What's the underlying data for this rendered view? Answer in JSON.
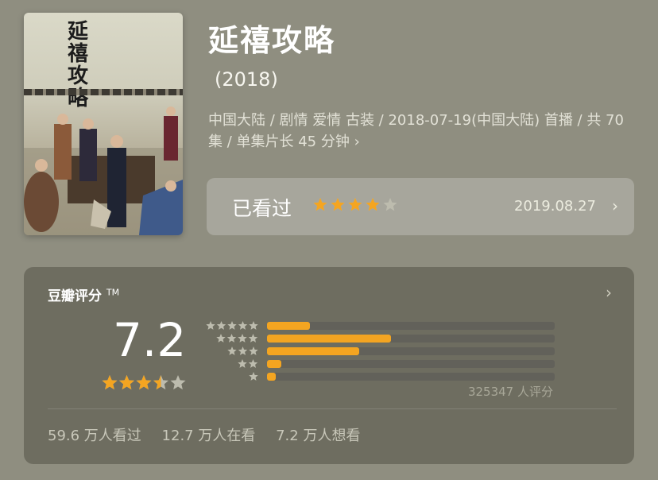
{
  "poster": {
    "title": "延禧攻略"
  },
  "movie": {
    "title": "延禧攻略",
    "year": "(2018)",
    "info": "中国大陆 / 剧情 爱情 古装 / 2018-07-19(中国大陆) 首播 / 共 70 集 / 单集片长 45 分钟",
    "info_chevron": "›"
  },
  "watched": {
    "label": "已看过",
    "user_rating": 4,
    "rating_max": 5,
    "date": "2019.08.27",
    "chevron": "›"
  },
  "rating": {
    "heading": "豆瓣评分",
    "trademark": "TM",
    "score": "7.2",
    "star_score": 3.5,
    "chevron": "›",
    "distribution": [
      {
        "stars": 5,
        "fraction": 0.15
      },
      {
        "stars": 4,
        "fraction": 0.43
      },
      {
        "stars": 3,
        "fraction": 0.32
      },
      {
        "stars": 2,
        "fraction": 0.05
      },
      {
        "stars": 1,
        "fraction": 0.03
      }
    ],
    "count": "325347 人评分"
  },
  "stats": {
    "watched": "59.6 万人看过",
    "watching": "12.7 万人在看",
    "want": "7.2 万人想看"
  },
  "colors": {
    "background": "#8f8e80",
    "card": "#6e6d60",
    "star": "#f4a521",
    "star_empty": "#bdbcae"
  }
}
